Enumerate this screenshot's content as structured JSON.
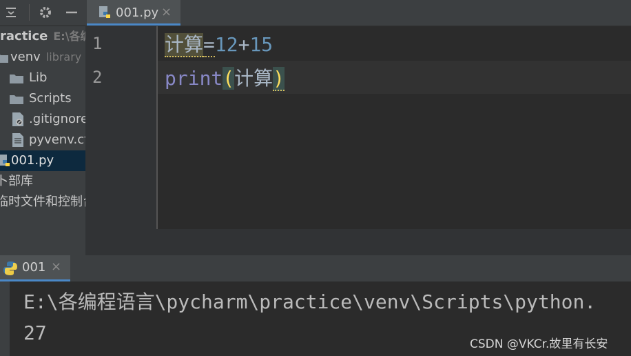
{
  "editor_tab": {
    "filename": "001.py",
    "close": "×"
  },
  "project_tree": {
    "items": [
      {
        "label": "ractice",
        "sub": "E:\\各编"
      },
      {
        "label": "venv",
        "sub": "library"
      },
      {
        "label": "Lib"
      },
      {
        "label": "Scripts"
      },
      {
        "label": ".gitignore"
      },
      {
        "label": "pyvenv.cfg"
      },
      {
        "label": "001.py"
      },
      {
        "label": "卜部库"
      },
      {
        "label": "临时文件和控制台"
      }
    ]
  },
  "editor": {
    "line_numbers": [
      "1",
      "2"
    ],
    "line1": {
      "ident": "计算",
      "op": "=",
      "num1": "12",
      "plus": "+",
      "num2": "15"
    },
    "line2": {
      "func": "print",
      "open": "(",
      "arg": "计算",
      "close": ")"
    }
  },
  "run_panel": {
    "tab_label": "001",
    "close": "×",
    "console_lines": [
      "E:\\各编程语言\\pycharm\\practice\\venv\\Scripts\\python.",
      "27"
    ]
  },
  "watermark": "CSDN @VKCr.故里有长安",
  "colors": {
    "accent": "#4a88c7",
    "number": "#6897bb",
    "builtin": "#8888c6",
    "paren": "#fede5d"
  }
}
